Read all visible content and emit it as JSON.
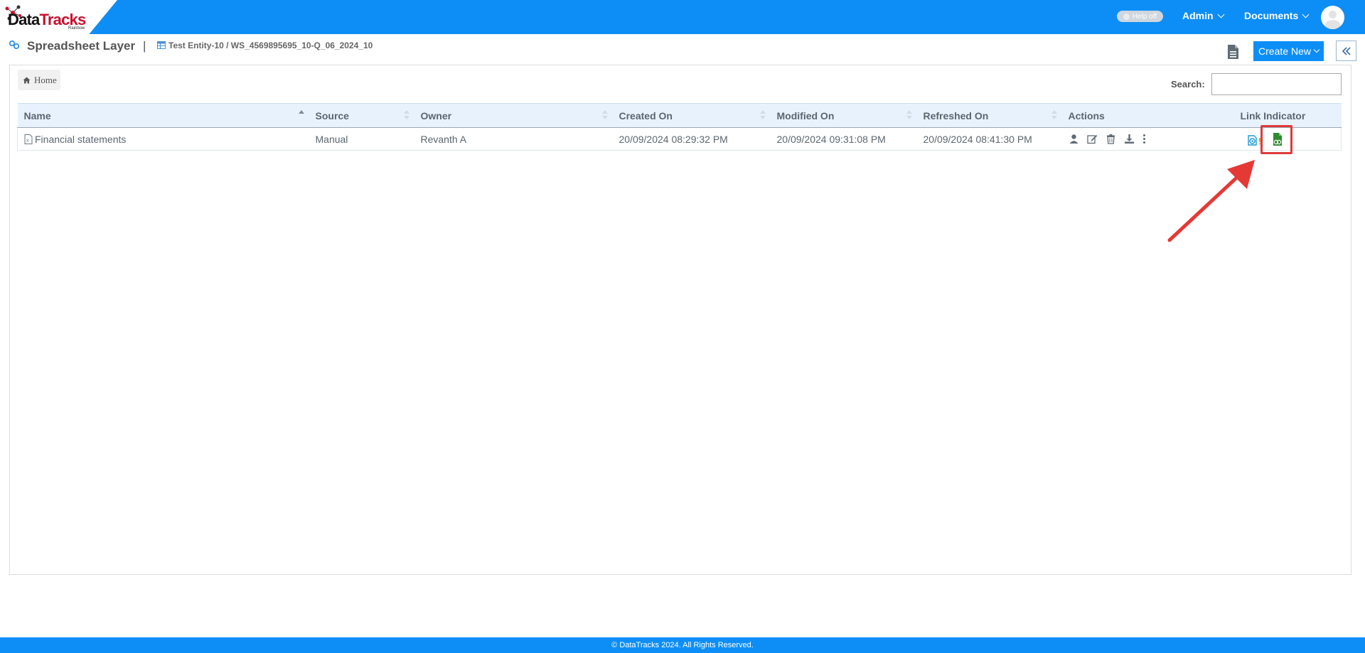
{
  "brand": {
    "logo_text_dark": "Data",
    "logo_text_red": "Tracks",
    "logo_subtext": "Rainbow"
  },
  "topbar": {
    "help_toggle": "Help off",
    "admin_menu": "Admin",
    "documents_menu": "Documents",
    "avatar_icon": "user-avatar-icon"
  },
  "header": {
    "title": "Spreadsheet Layer",
    "separator": "|",
    "breadcrumb_path": "Test Entity-10 / WS_4569895695_10-Q_06_2024_10",
    "create_new_label": "Create New"
  },
  "content": {
    "home_label": "Home",
    "search_label": "Search:",
    "search_value": "",
    "columns": [
      "Name",
      "Source",
      "Owner",
      "Created On",
      "Modified On",
      "Refreshed On",
      "Actions",
      "Link Indicator"
    ],
    "sorted_column": "Name",
    "rows": [
      {
        "name": "Financial statements",
        "source": "Manual",
        "owner": "Revanth A",
        "created_on": "20/09/2024 08:29:32 PM",
        "modified_on": "20/09/2024 09:31:08 PM",
        "refreshed_on": "20/09/2024 08:41:30 PM",
        "actions": [
          "user-icon",
          "edit-icon",
          "trash-icon",
          "download-icon",
          "more-vertical-icon"
        ],
        "link_indicators": [
          "linked-warning-icon",
          "excel-link-icon"
        ]
      }
    ]
  },
  "annotation": {
    "highlight_color": "#e03a3a",
    "target": "excel-link-icon"
  },
  "footer": {
    "copyright": "© DataTracks 2024. All Rights Reserved."
  },
  "colors": {
    "primary": "#0d8ef6",
    "header_row": "#e8f2fc",
    "text": "#5b6770"
  }
}
